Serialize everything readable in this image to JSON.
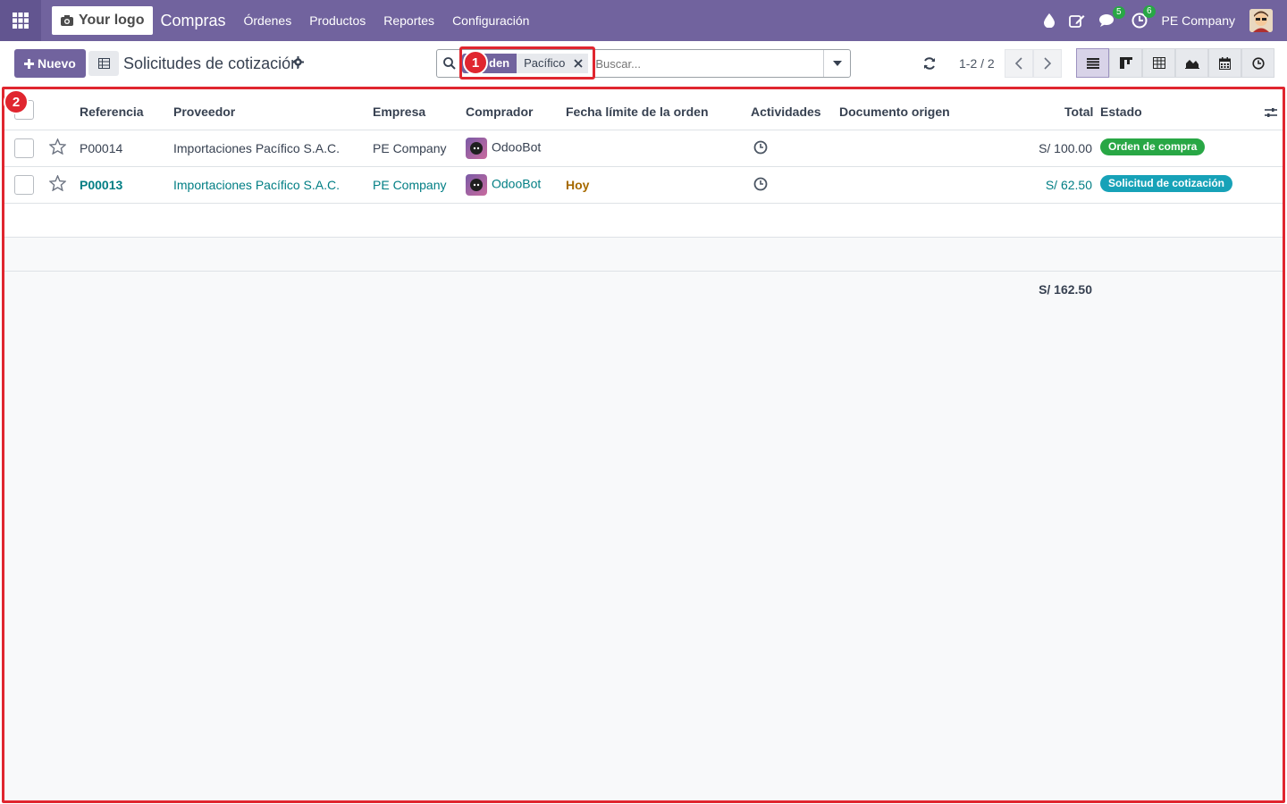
{
  "navbar": {
    "logo_text": "Your logo",
    "app_name": "Compras",
    "menu": [
      "Órdenes",
      "Productos",
      "Reportes",
      "Configuración"
    ],
    "messages_badge": "5",
    "activities_badge": "6",
    "company": "PE Company",
    "brand_color": "#71639e"
  },
  "control": {
    "new_label": "Nuevo",
    "title": "Solicitudes de cotización",
    "search": {
      "facet_label": "den",
      "facet_value": "Pacífico",
      "placeholder": "Buscar..."
    },
    "pager": "1-2 / 2"
  },
  "annotations": [
    "1",
    "2"
  ],
  "table": {
    "headers": {
      "referencia": "Referencia",
      "proveedor": "Proveedor",
      "empresa": "Empresa",
      "comprador": "Comprador",
      "fecha": "Fecha límite de la orden",
      "actividades": "Actividades",
      "documento": "Documento origen",
      "total": "Total",
      "estado": "Estado"
    },
    "rows": [
      {
        "ref": "P00014",
        "proveedor": "Importaciones Pacífico S.A.C.",
        "empresa": "PE Company",
        "comprador": "OdooBot",
        "fecha": "",
        "total": "S/ 100.00",
        "estado": "Orden de compra",
        "estado_color": "#28a745"
      },
      {
        "ref": "P00013",
        "proveedor": "Importaciones Pacífico S.A.C.",
        "empresa": "PE Company",
        "comprador": "OdooBot",
        "fecha": "Hoy",
        "total": "S/ 62.50",
        "estado": "Solicitud de cotización",
        "estado_color": "#17a2b8"
      }
    ],
    "grand_total": "S/ 162.50"
  }
}
